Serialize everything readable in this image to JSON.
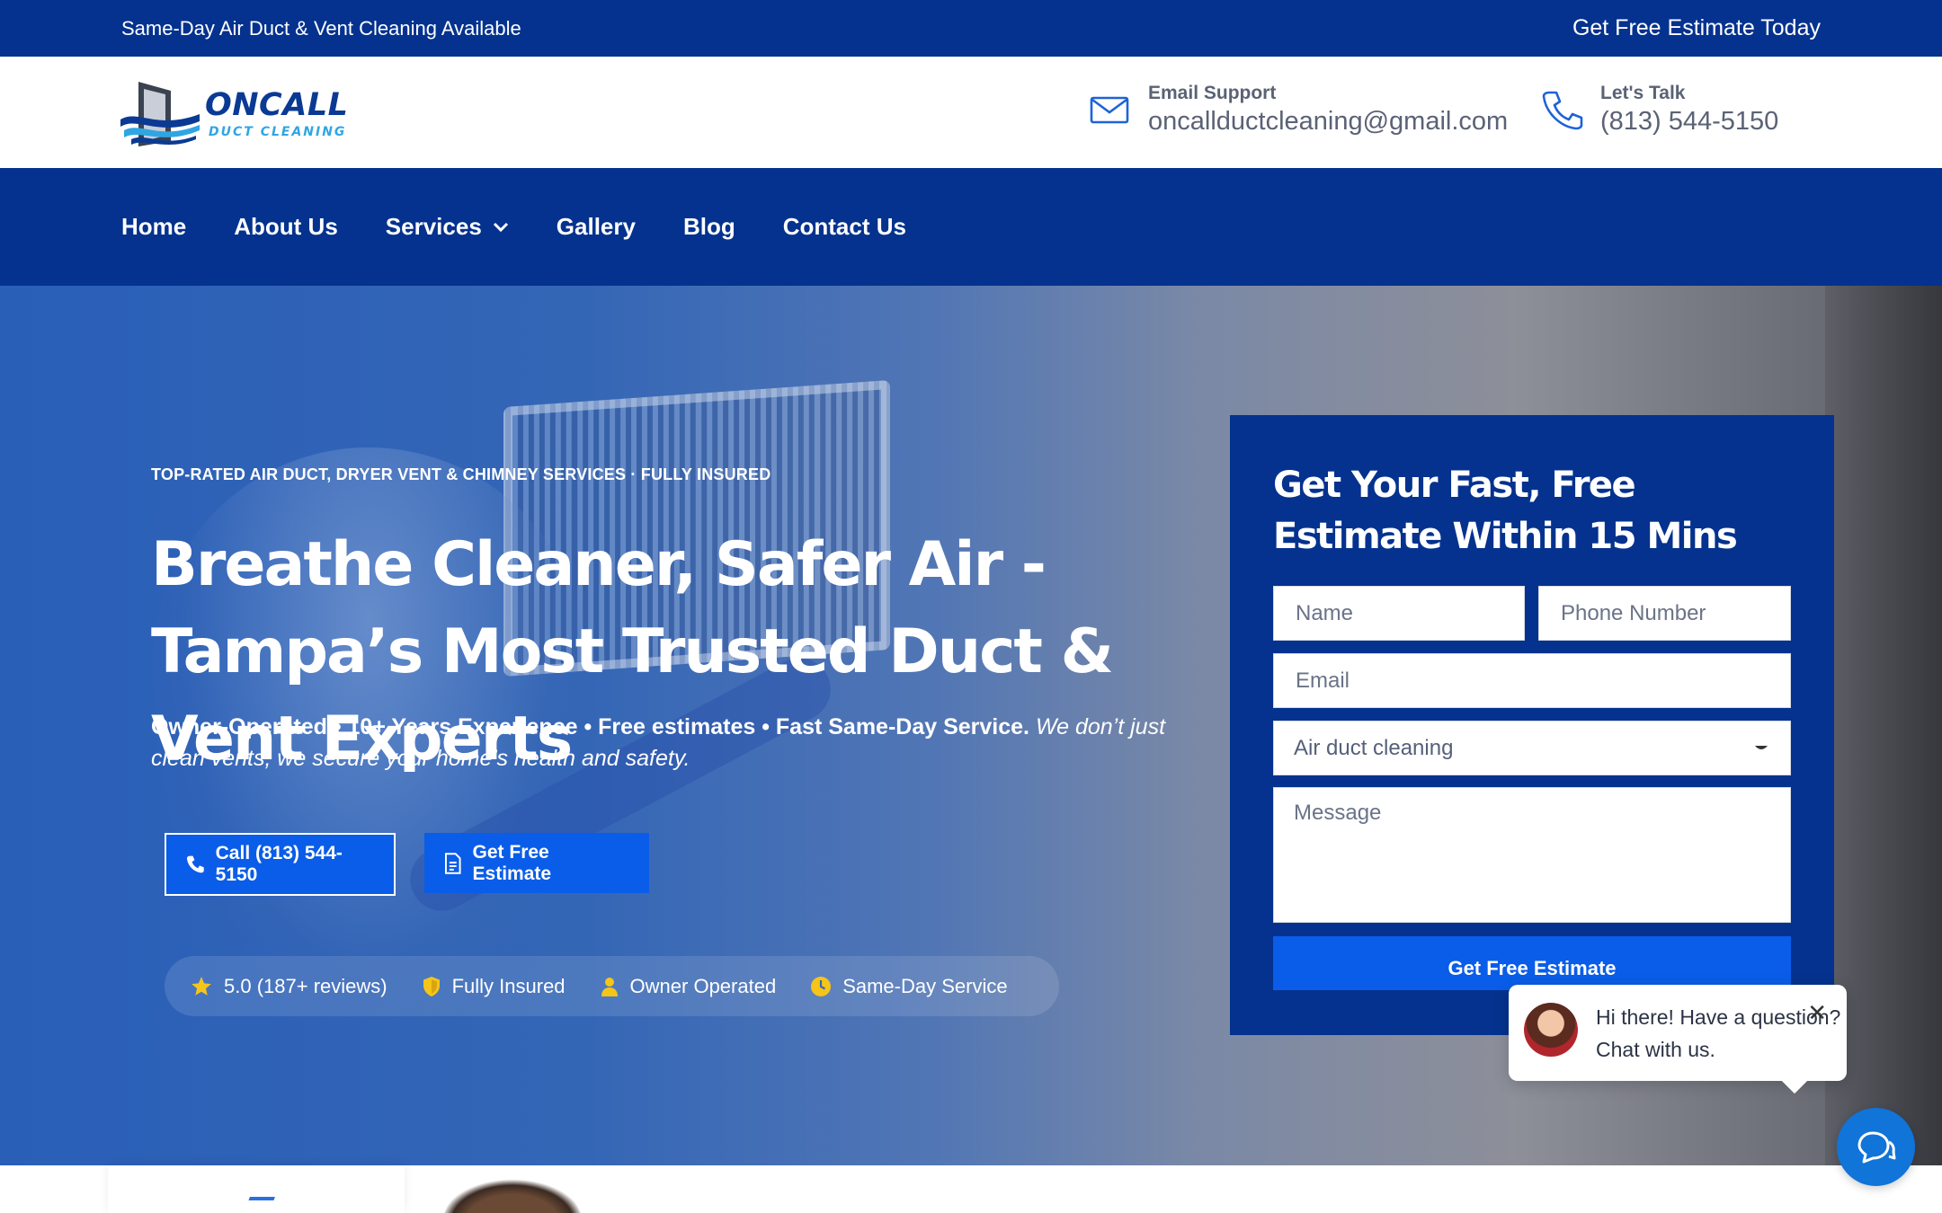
{
  "topbar": {
    "announcement": "Same-Day Air Duct & Vent Cleaning Available",
    "cta": "Get Free Estimate Today"
  },
  "brand": {
    "name": "ONCALL",
    "tagline": "DUCT CLEANING"
  },
  "header": {
    "email": {
      "label": "Email Support",
      "value": "oncallductcleaning@gmail.com",
      "icon": "mail-icon"
    },
    "phone": {
      "label": "Let's Talk",
      "value": "(813) 544-5150",
      "icon": "phone-icon"
    }
  },
  "nav": {
    "items": [
      "Home",
      "About Us",
      "Services",
      "Gallery",
      "Blog",
      "Contact Us"
    ]
  },
  "hero": {
    "eyebrow": "TOP-RATED AIR DUCT, DRYER VENT & CHIMNEY SERVICES · FULLY INSURED",
    "headline": "Breathe Cleaner, Safer Air - Tampa’s Most Trusted Duct & Vent Experts",
    "lede_bold": "Owner-Operated • 10+ Years Experience • Free estimates  • Fast Same-Day Service.",
    "lede_italic": "We don’t just clean vents; we secure your home’s health and safety.",
    "call_button": "Call (813) 544-5150",
    "estimate_button": "Get Free Estimate",
    "trust": [
      {
        "text": "5.0 (187+ reviews)",
        "icon": "star-icon"
      },
      {
        "text": "Fully Insured",
        "icon": "shield-icon"
      },
      {
        "text": "Owner Operated",
        "icon": "person-icon"
      },
      {
        "text": "Same-Day Service",
        "icon": "clock-icon"
      }
    ]
  },
  "form": {
    "title": "Get Your Fast, Free Estimate Within 15 Mins",
    "name_placeholder": "Name",
    "phone_placeholder": "Phone Number",
    "email_placeholder": "Email",
    "service_selected": "Air duct cleaning",
    "message_placeholder": "Message",
    "submit": "Get Free Estimate"
  },
  "chat": {
    "line1": "Hi there! Have a question?",
    "line2": "Chat with us."
  },
  "colors": {
    "brand_navy": "#04328e",
    "accent_blue": "#0a5de8",
    "logo_cyan": "#2fa6e3",
    "star_yellow": "#f5c518"
  }
}
